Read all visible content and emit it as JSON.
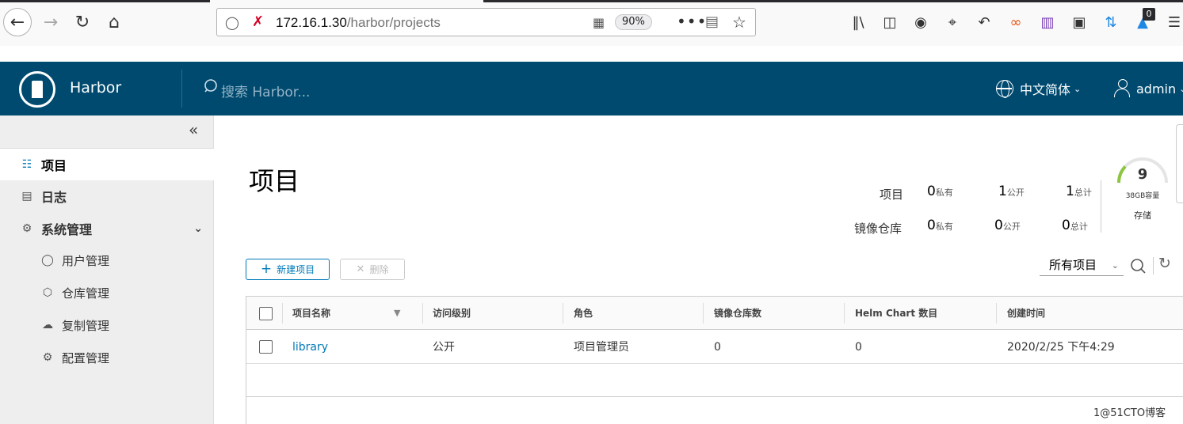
{
  "browser": {
    "url_host": "172.16.1.30",
    "url_path": "/harbor/projects",
    "zoom": "90%",
    "notification_badge": "0"
  },
  "header": {
    "brand": "Harbor",
    "search_placeholder": "搜索 Harbor...",
    "language": "中文简体",
    "user": "admin"
  },
  "sidebar": {
    "items": [
      {
        "label": "项目",
        "icon": "project-icon"
      },
      {
        "label": "日志",
        "icon": "log-icon"
      },
      {
        "label": "系统管理",
        "icon": "admin-icon"
      },
      {
        "label": "用户管理",
        "icon": "users-icon"
      },
      {
        "label": "仓库管理",
        "icon": "registry-icon"
      },
      {
        "label": "复制管理",
        "icon": "replication-icon"
      },
      {
        "label": "配置管理",
        "icon": "config-icon"
      }
    ]
  },
  "main": {
    "title": "项目",
    "stats": {
      "projects_label": "项目",
      "repos_label": "镜像仓库",
      "private_label": "私有",
      "public_label": "公开",
      "total_label": "总计",
      "projects_private": "0",
      "projects_public": "1",
      "projects_total": "1",
      "repos_private": "0",
      "repos_public": "0",
      "repos_total": "0"
    },
    "storage": {
      "value": "9",
      "capacity": "38GB容量",
      "label": "存储",
      "used_fraction": 0.24
    },
    "buttons": {
      "new_project": "新建项目",
      "delete": "删除"
    },
    "filter": "所有项目",
    "table": {
      "headers": [
        "项目名称",
        "访问级别",
        "角色",
        "镜像仓库数",
        "Helm Chart 数目",
        "创建时间"
      ],
      "rows": [
        {
          "name": "library",
          "access": "公开",
          "role": "项目管理员",
          "repos": "0",
          "charts": "0",
          "created": "2020/2/25 下午4:29"
        }
      ]
    }
  },
  "watermark": "1@51CTO博客",
  "colors": {
    "header_bg": "#004a70",
    "accent": "#0079b8",
    "gauge_green": "#8cc63f"
  }
}
